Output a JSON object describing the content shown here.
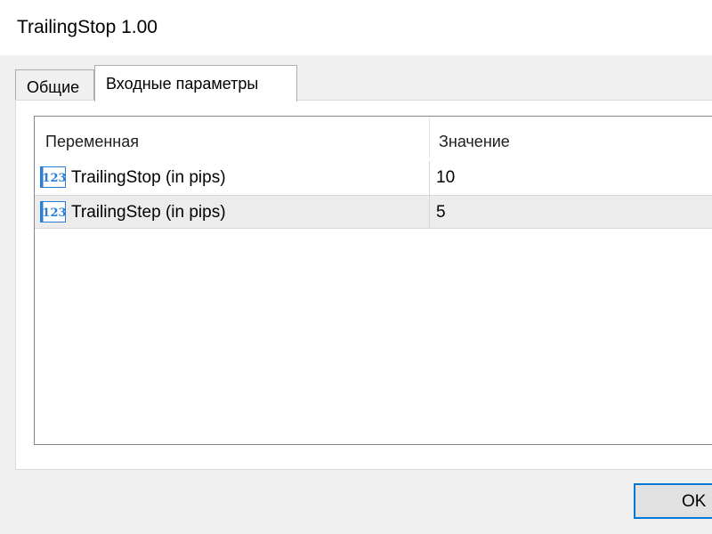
{
  "window": {
    "title": "TrailingStop 1.00"
  },
  "tabs": [
    {
      "label": "Общие",
      "active": false
    },
    {
      "label": "Входные параметры",
      "active": true
    }
  ],
  "table": {
    "columns": [
      "Переменная",
      "Значение"
    ],
    "rows": [
      {
        "icon": "numeric-123-icon",
        "name": "TrailingStop (in pips)",
        "value": "10",
        "selected": false
      },
      {
        "icon": "numeric-123-icon",
        "name": "TrailingStep (in pips)",
        "value": "5",
        "selected": true
      }
    ]
  },
  "buttons": {
    "ok": "OK"
  },
  "colors": {
    "window_bg": "#f0f0f0",
    "title_bg": "#ffffff",
    "selected_row_bg": "#ececec",
    "focus_border": "#0078d7",
    "icon_blue": "#2a7fd4"
  }
}
